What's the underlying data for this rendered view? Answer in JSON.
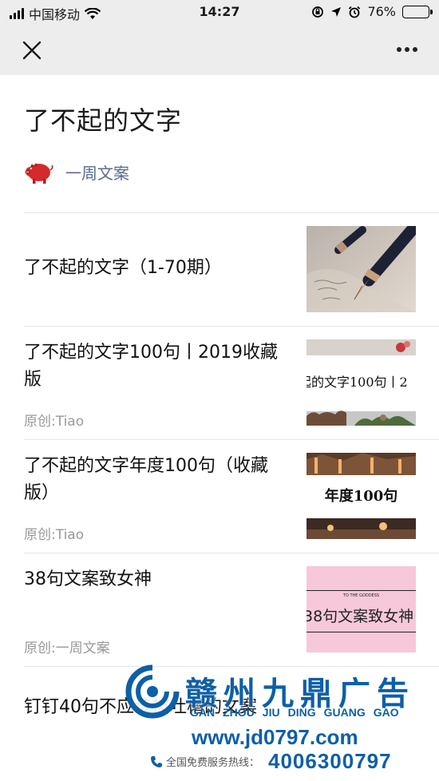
{
  "status_bar": {
    "carrier": "中国移动",
    "time": "14:27",
    "battery_percent": "76%",
    "battery_level": 0.76
  },
  "navbar": {
    "close_icon": "close-icon",
    "more_icon": "more-icon"
  },
  "page": {
    "title": "了不起的文字",
    "author": "一周文案",
    "author_icon": "pig-avatar-icon",
    "accent_color": "#576b95"
  },
  "articles": [
    {
      "title": "了不起的文字（1-70期）",
      "source": "",
      "thumb_text": ""
    },
    {
      "title": "了不起的文字100句丨2019收藏版",
      "source": "原创:Tiao",
      "thumb_text": "起的文字100句丨2"
    },
    {
      "title": "了不起的文字年度100句（收藏版）",
      "source": "原创:Tiao",
      "thumb_text": "年度100句"
    },
    {
      "title": "38句文案致女神",
      "source": "原创:一周文案",
      "thumb_text": "38句文案致女神",
      "thumb_small_text": "TO THE GODDESS"
    },
    {
      "title": "钉钉40句不应该被吐槽的文案",
      "source": "",
      "thumb_text": ""
    }
  ],
  "watermark": {
    "brand": "赣州九鼎广告",
    "pinyin": [
      "GAN",
      "ZHOU",
      "JIU",
      "DING",
      "GUANG",
      "GAO"
    ],
    "site": "www.jd0797.com",
    "hotline_label": "全国免费服务热线：",
    "phone": "4006300797"
  }
}
